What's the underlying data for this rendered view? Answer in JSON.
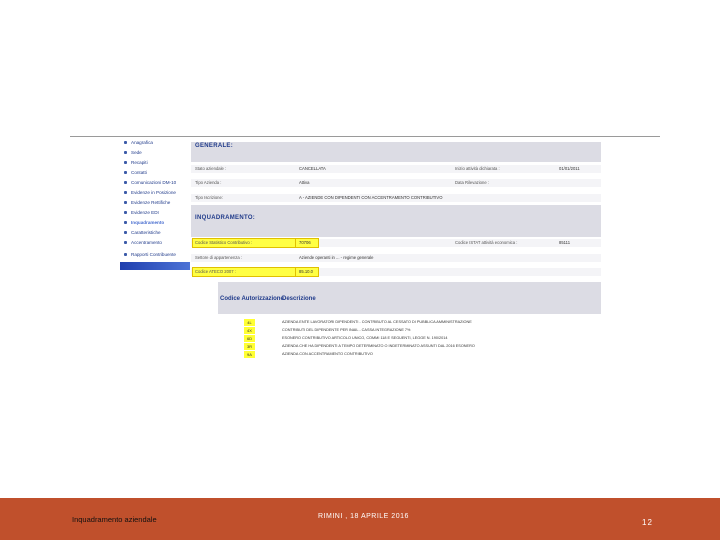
{
  "sidebar": {
    "items": [
      {
        "label": "Anagrafica"
      },
      {
        "label": "Sede"
      },
      {
        "label": "Recapiti"
      },
      {
        "label": "Contatti"
      },
      {
        "label": "Comunicazioni DM-10"
      },
      {
        "label": "Evidenze in Posizione"
      },
      {
        "label": "Evidenze Rettifiche"
      },
      {
        "label": "Evidenze EDI"
      },
      {
        "label": "Inquadramento"
      },
      {
        "label": "Caratteristiche"
      },
      {
        "label": "Accentramento"
      },
      {
        "label": "Rapporti Contribuente"
      }
    ]
  },
  "generale": {
    "title": "GENERALE:",
    "stato_label": "Stato aziendale :",
    "stato_value": "CANCELLATA",
    "inizio_label": "Inizio attività dichiarata :",
    "inizio_value": "01/01/2011",
    "tipo_label": "Tipo Azienda :",
    "tipo_value": "Attiva",
    "fine_label": "Data Rilevazione :",
    "fine_value": "",
    "tipo_iscr_label": "Tipo Iscrizione:",
    "tipo_iscr_value": "A - AZIENDE CON DIPENDENTI CON ACCENTRAMENTO CONTRIBUTIVO"
  },
  "inquadramento": {
    "title": "INQUADRAMENTO:",
    "csc_label": "Codice Statistico Contributivo :",
    "csc_value": "70706",
    "istat_label": "Codice ISTAT attività economica :",
    "istat_value": "85111",
    "settore_label": "Settore di appartenenza :",
    "settore_value": "Aziende operanti in ... - regime generale",
    "ateco_label": "Codice ATECO 2007 :",
    "ateco_value": "85.10.0"
  },
  "codici": {
    "header_code": "Codice Autorizzazione",
    "header_desc": "Descrizione",
    "rows": [
      {
        "code": "4L",
        "desc": "AZIENDA ENTE LAVORATORI DIPENDENTI - CONTRIBUTO AL CESSATO DI PUBBLICA AMMINISTRAZIONE"
      },
      {
        "code": "4X",
        "desc": "CONTRIBUTI DEL DIPENDENTE PER INAIL - CASSA INTEGRAZIONE 7%"
      },
      {
        "code": "6D",
        "desc": "ESONERO CONTRIBUTIVO ARTICOLO UNICO, COMMI 118 E SEGUENTI, LEGGE N. 190/2014"
      },
      {
        "code": "3R",
        "desc": "AZIENDA CHE HA DIPENDENTI A TEMPO DETERMINATO O INDETERMINATO ASSUNTI DAL 2016 ESONERO"
      },
      {
        "code": "9A",
        "desc": "AZIENDA CON ACCENTRAMENTO CONTRIBUTIVO"
      }
    ]
  },
  "footer": {
    "left": "Inquadramento aziendale",
    "center": "RIMINI , 18 APRILE 2016",
    "page": "12"
  },
  "colors": {
    "footer_bg": "#c0502c",
    "highlight": "#ffff44",
    "nav_blue": "#1f3a8a"
  }
}
